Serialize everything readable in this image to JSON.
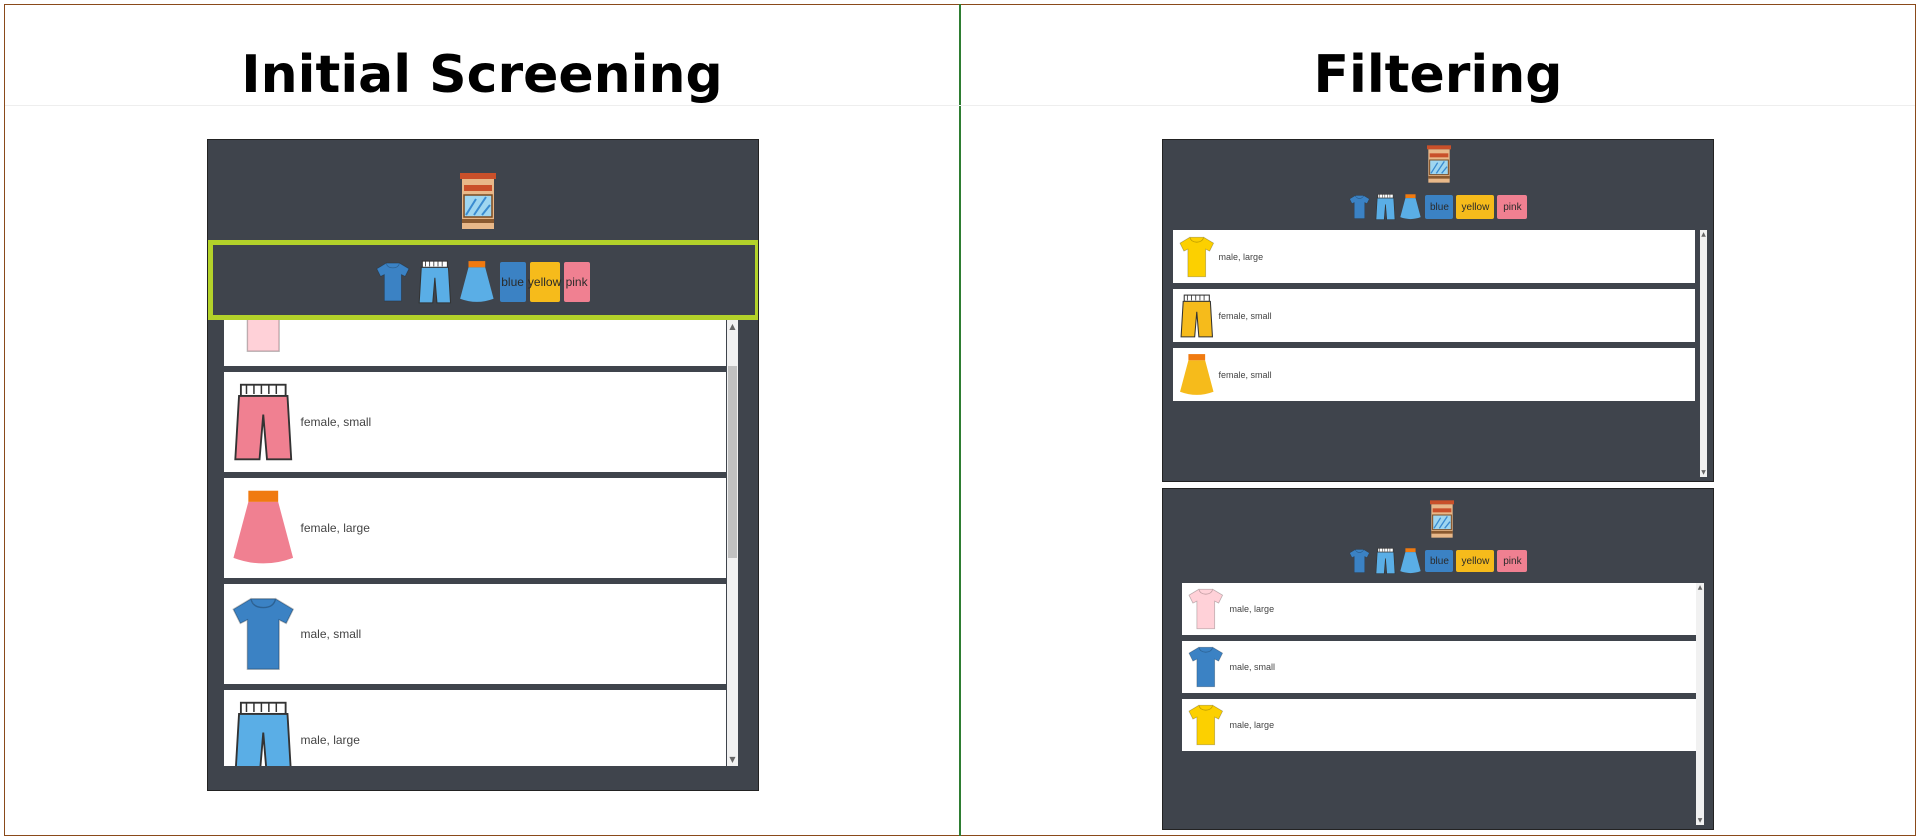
{
  "headings": {
    "left": "Initial Screening",
    "right": "Filtering"
  },
  "colors": {
    "panel": "#3f444c",
    "blue": "#3b82c4",
    "lightblue": "#5aaee6",
    "yellow": "#f6bb1b",
    "shirt_yellow": "#fcd000",
    "pink": "#f08091",
    "lightpink": "#ffd1d8",
    "highlight": "#b3d22a"
  },
  "filter": {
    "blue": "blue",
    "yellow": "yellow",
    "pink": "pink"
  },
  "icons": {
    "store": "store-icon",
    "shirt": "tshirt-icon",
    "shorts": "shorts-icon",
    "skirt": "skirt-icon"
  },
  "left_list": [
    {
      "icon": "tshirt-icon",
      "color": "lightpink",
      "desc": ""
    },
    {
      "icon": "shorts-icon",
      "color": "pink",
      "desc": "female, small"
    },
    {
      "icon": "skirt-icon",
      "color": "pink",
      "desc": "female, large"
    },
    {
      "icon": "tshirt-icon",
      "color": "blue",
      "desc": "male, small"
    },
    {
      "icon": "shorts-icon",
      "color": "lightblue",
      "desc": "male, large"
    }
  ],
  "right_top_list": [
    {
      "icon": "tshirt-icon",
      "color": "shirt_yellow",
      "desc": "male, large"
    },
    {
      "icon": "shorts-icon",
      "color": "yellow",
      "desc": "female, small"
    },
    {
      "icon": "skirt-icon",
      "color": "yellow",
      "desc": "female, small"
    }
  ],
  "right_bottom_list": [
    {
      "icon": "tshirt-icon",
      "color": "lightpink",
      "desc": "male, large"
    },
    {
      "icon": "tshirt-icon",
      "color": "blue",
      "desc": "male, small"
    },
    {
      "icon": "tshirt-icon",
      "color": "shirt_yellow",
      "desc": "male, large"
    }
  ]
}
